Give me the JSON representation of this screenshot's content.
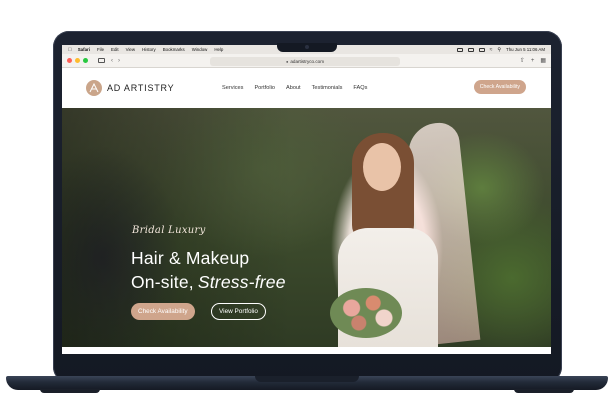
{
  "menubar": {
    "apple": "",
    "items": [
      "Safari",
      "File",
      "Edit",
      "View",
      "History",
      "Bookmarks",
      "Window",
      "Help"
    ],
    "clock": "Thu Jun 5  11:06 AM"
  },
  "browser": {
    "url": "adartistryco.com"
  },
  "site": {
    "brand": "AD ARTISTRY",
    "nav": [
      "Services",
      "Portfolio",
      "About",
      "Testimonials",
      "FAQs"
    ],
    "cta": "Check Availability"
  },
  "hero": {
    "script": "Bridal Luxury",
    "title": "Hair & Makeup",
    "subtitle_plain": "On-site,",
    "subtitle_italic": "Stress-free",
    "btn_primary": "Check Availability",
    "btn_secondary": "View Portfolio"
  },
  "colors": {
    "accent": "#cfa58c",
    "frame": "#1c2230",
    "menubar": "#e9e6e2"
  }
}
